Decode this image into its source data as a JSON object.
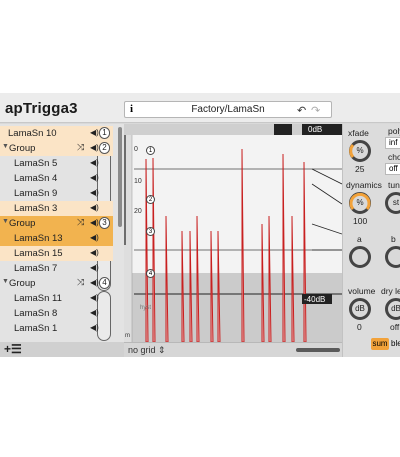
{
  "app": {
    "title": "apTrigga3"
  },
  "preset": {
    "info": "i",
    "name": "Factory/LamaSn",
    "undo": "↶",
    "redo": "↷"
  },
  "list": {
    "items": [
      {
        "label": "LamaSn 10",
        "type": "sample",
        "state": "hl",
        "num": "1"
      },
      {
        "label": "Group",
        "type": "group",
        "state": "hl",
        "num": "2"
      },
      {
        "label": "LamaSn 5",
        "type": "sample",
        "state": ""
      },
      {
        "label": "LamaSn 4",
        "type": "sample",
        "state": ""
      },
      {
        "label": "LamaSn 9",
        "type": "sample",
        "state": ""
      },
      {
        "label": "LamaSn 3",
        "type": "sample",
        "state": "hl"
      },
      {
        "label": "Group",
        "type": "group",
        "state": "sel",
        "num": "3"
      },
      {
        "label": "LamaSn 13",
        "type": "sample",
        "state": "sel"
      },
      {
        "label": "LamaSn 15",
        "type": "sample",
        "state": "hl"
      },
      {
        "label": "LamaSn 7",
        "type": "sample",
        "state": ""
      },
      {
        "label": "Group",
        "type": "group",
        "state": "",
        "num": "4"
      },
      {
        "label": "LamaSn 11",
        "type": "sample",
        "state": ""
      },
      {
        "label": "LamaSn 8",
        "type": "sample",
        "state": ""
      },
      {
        "label": "LamaSn 1",
        "type": "sample",
        "state": ""
      }
    ],
    "add_label": "+☰",
    "speaker": "◀)",
    "shuffle": "⤨",
    "triangle": "▼"
  },
  "wave": {
    "top_db": "0dB",
    "bottom_db": "-40dB",
    "ruler": [
      "0",
      "10",
      "20"
    ],
    "markers": [
      "1",
      "2",
      "3",
      "4"
    ],
    "thresh_label": "hyst",
    "footer": {
      "grid": "no grid ⇕"
    },
    "m_label": "m"
  },
  "panel": {
    "xfade": {
      "label": "xfade",
      "unit": "%",
      "value": "25"
    },
    "poly": {
      "label": "poly",
      "value": "inf"
    },
    "choke": {
      "label": "chok",
      "value": "off"
    },
    "dynamics": {
      "label": "dynamics",
      "unit": "%",
      "value": "100"
    },
    "tune": {
      "label": "tuni",
      "value": "st"
    },
    "a": {
      "label": "a"
    },
    "b": {
      "label": "b"
    },
    "volume": {
      "label": "volume",
      "unit": "dB",
      "value": "0"
    },
    "drylevel": {
      "label": "dry lev",
      "unit": "dB",
      "value": "off"
    },
    "sum": "sum",
    "blend": "ble",
    "accent": "#f2a23a"
  }
}
